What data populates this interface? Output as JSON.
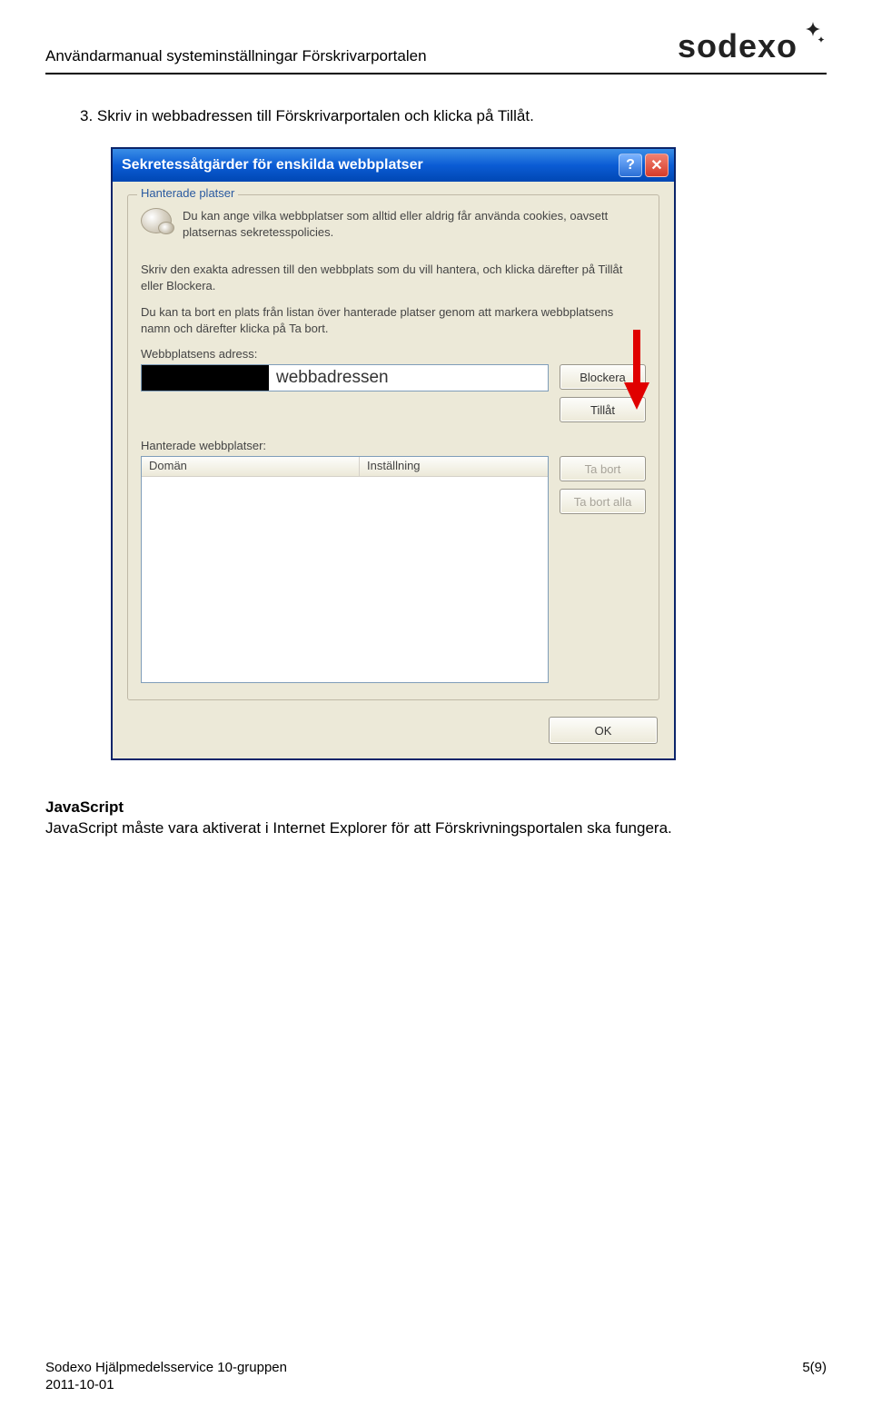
{
  "header": {
    "title": "Användarmanual systeminställningar Förskrivarportalen",
    "logo_text": "sodexo"
  },
  "instruction": {
    "number": "3.",
    "text": "Skriv in webbadressen till Förskrivarportalen och klicka på Tillåt."
  },
  "dialog": {
    "title": "Sekretessåtgärder för enskilda webbplatser",
    "help_glyph": "?",
    "close_glyph": "✕",
    "group_title": "Hanterade platser",
    "para1": "Du kan ange vilka webbplatser som alltid eller aldrig får använda cookies, oavsett platsernas sekretesspolicies.",
    "para2": "Skriv den exakta adressen till den webbplats som du vill hantera, och klicka därefter på Tillåt eller Blockera.",
    "para3": "Du kan ta bort en plats från listan över hanterade platser genom att markera webbplatsens namn och därefter klicka på Ta bort.",
    "address_label": "Webbplatsens adress:",
    "address_value": "webbadressen",
    "btn_block": "Blockera",
    "btn_allow": "Tillåt",
    "managed_label": "Hanterade webbplatser:",
    "col_domain": "Domän",
    "col_setting": "Inställning",
    "btn_remove": "Ta bort",
    "btn_remove_all": "Ta bort alla",
    "btn_ok": "OK"
  },
  "section": {
    "heading": "JavaScript",
    "body": "JavaScript måste vara aktiverat i Internet Explorer för att Förskrivningsportalen ska fungera."
  },
  "footer": {
    "org": "Sodexo Hjälpmedelsservice 10-gruppen",
    "date": "2011-10-01",
    "page": "5(9)"
  }
}
